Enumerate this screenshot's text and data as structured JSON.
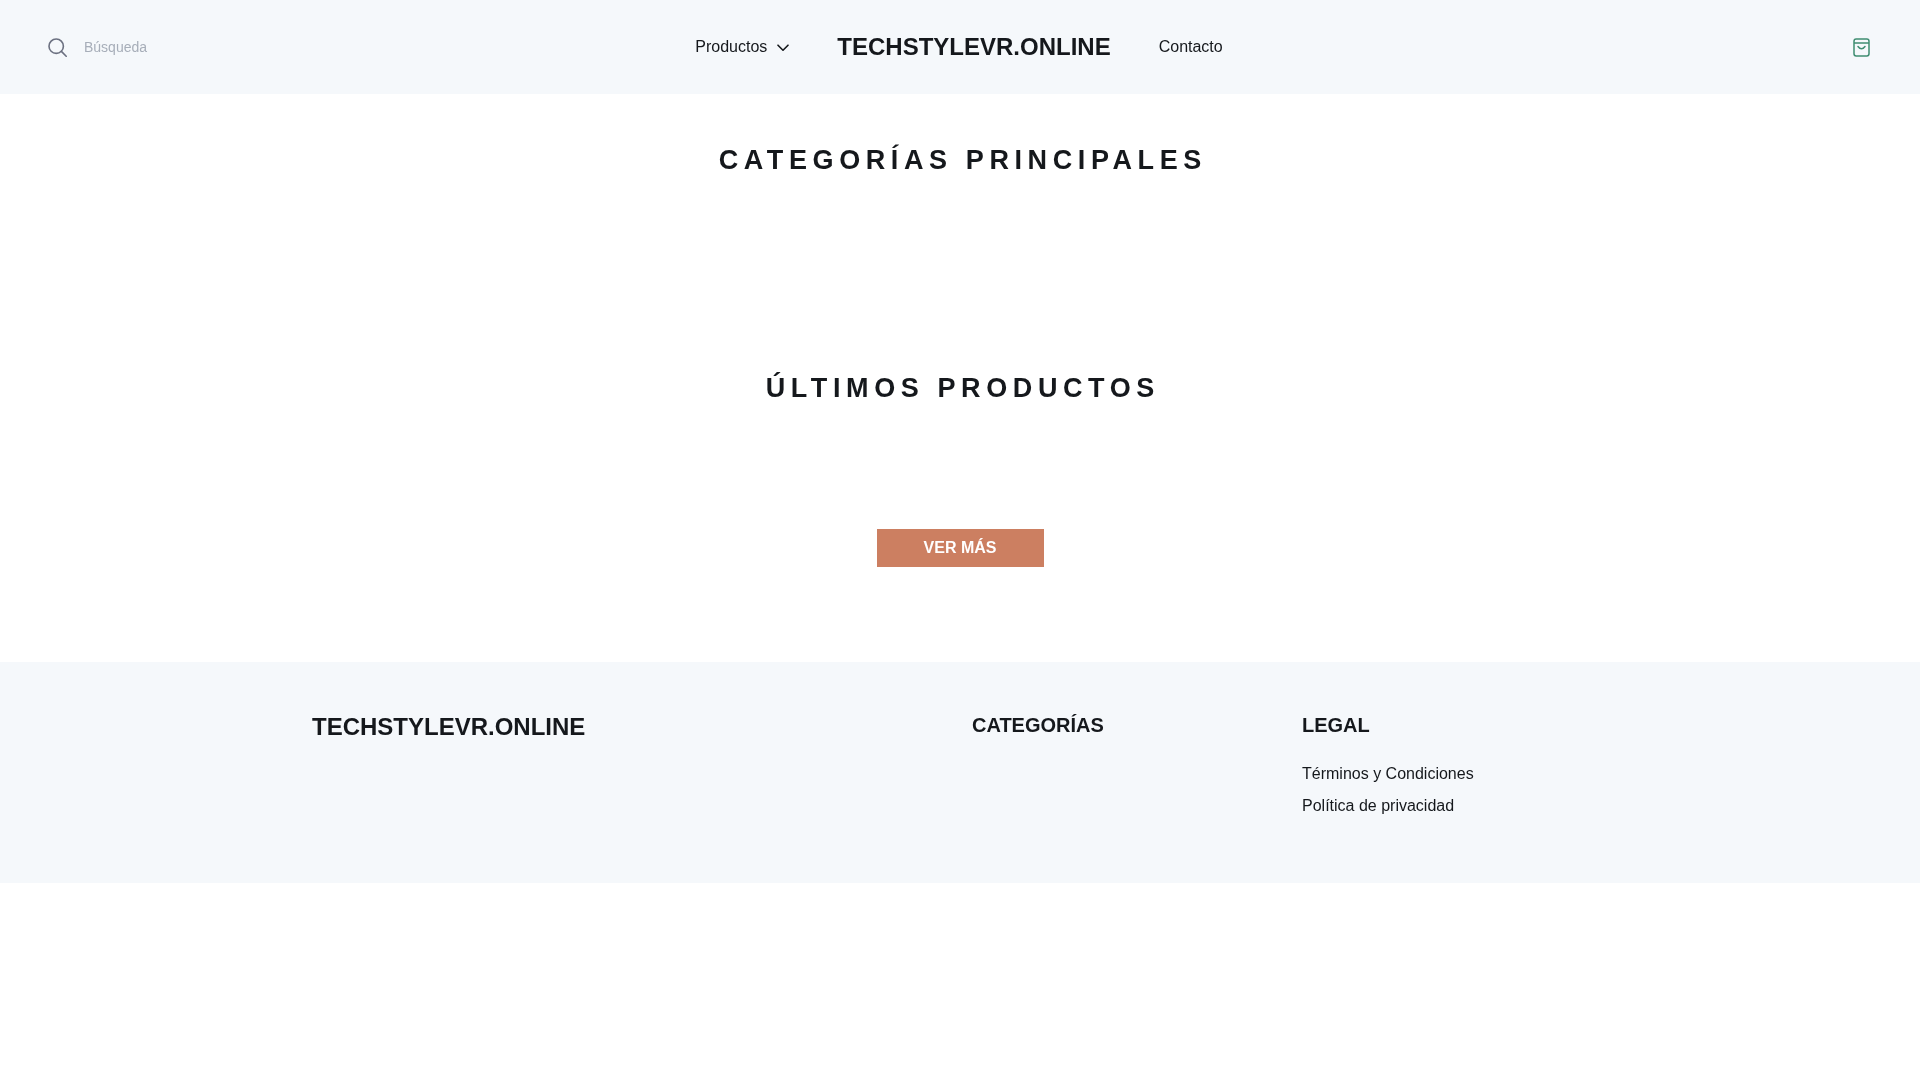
{
  "header": {
    "search": {
      "placeholder": "Búsqueda"
    },
    "nav": [
      {
        "kind": "dropdown",
        "label": "Productos"
      },
      {
        "kind": "logo",
        "label": "TECHSTYLEVR.ONLINE"
      },
      {
        "kind": "link",
        "label": "Contacto"
      }
    ]
  },
  "sections": [
    {
      "title": "CATEGORÍAS PRINCIPALES"
    },
    {
      "title": "ÚLTIMOS PRODUCTOS",
      "button": "VER MÁS"
    }
  ],
  "footer": {
    "brand": "TECHSTYLEVR.ONLINE",
    "columns": [
      {
        "title": "CATEGORÍAS"
      },
      {
        "title": "LEGAL",
        "links": [
          "Términos y Condiciones",
          "Política de privacidad"
        ]
      }
    ]
  }
}
